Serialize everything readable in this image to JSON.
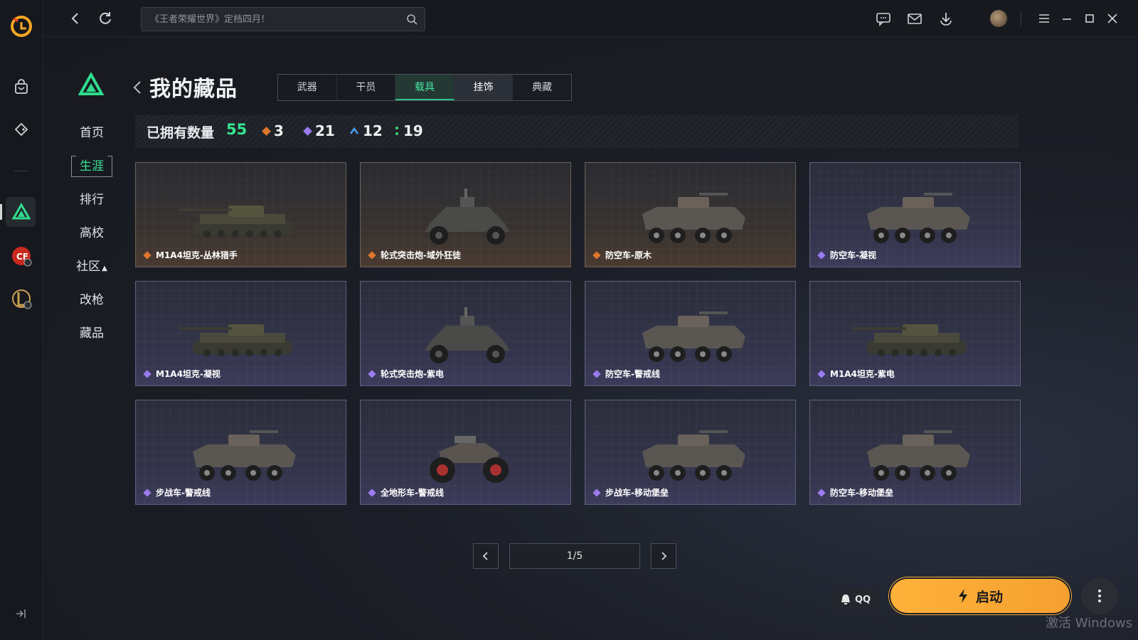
{
  "search": {
    "placeholder": "《王者荣耀世界》定档四月!"
  },
  "menu": {
    "items": [
      {
        "label": "首页"
      },
      {
        "label": "生涯"
      },
      {
        "label": "排行"
      },
      {
        "label": "高校"
      },
      {
        "label": "社区"
      },
      {
        "label": "改枪"
      },
      {
        "label": "藏品"
      }
    ],
    "active": "生涯"
  },
  "page": {
    "title": "我的藏品"
  },
  "tabs": [
    {
      "label": "武器"
    },
    {
      "label": "干员"
    },
    {
      "label": "载具"
    },
    {
      "label": "挂饰"
    },
    {
      "label": "典藏"
    }
  ],
  "stats": {
    "owned_label": "已拥有数量",
    "owned_total": "55",
    "orange_count": "3",
    "purple_count": "21",
    "blue_count": "12",
    "green_count": "19"
  },
  "colors": {
    "accent_green": "#36e68e",
    "rarity_orange": "#e0772f",
    "rarity_purple": "#9a7cf0",
    "rarity_blue": "#4ea0f0",
    "rarity_green": "#3fd27a",
    "start_button": "#ffb23a"
  },
  "cards": [
    {
      "name": "M1A4坦克-丛林猎手",
      "rarity": "orange",
      "type": "tank"
    },
    {
      "name": "轮式突击炮-域外狂徒",
      "rarity": "orange",
      "type": "buggy"
    },
    {
      "name": "防空车-原木",
      "rarity": "orange",
      "type": "apc"
    },
    {
      "name": "防空车-凝视",
      "rarity": "purple",
      "type": "apc"
    },
    {
      "name": "M1A4坦克-凝视",
      "rarity": "purple",
      "type": "tank"
    },
    {
      "name": "轮式突击炮-紫电",
      "rarity": "purple",
      "type": "buggy"
    },
    {
      "name": "防空车-警戒线",
      "rarity": "purple",
      "type": "apc"
    },
    {
      "name": "M1A4坦克-紫电",
      "rarity": "purple",
      "type": "tank"
    },
    {
      "name": "步战车-警戒线",
      "rarity": "purple",
      "type": "apc"
    },
    {
      "name": "全地形车-警戒线",
      "rarity": "purple",
      "type": "atv"
    },
    {
      "name": "步战车-移动堡垒",
      "rarity": "purple",
      "type": "apc"
    },
    {
      "name": "防空车-移动堡垒",
      "rarity": "purple",
      "type": "apc"
    }
  ],
  "pager": {
    "text": "1/5"
  },
  "launch": {
    "qq_label": "QQ",
    "start_label": "启动"
  },
  "watermark": "激活 Windows",
  "icons": [
    "app-logo-icon",
    "bag-icon",
    "tag-icon",
    "delta-force-icon",
    "cf-icon",
    "lol-icon",
    "collapse-icon",
    "back-icon",
    "refresh-icon",
    "search-icon",
    "chat-icon",
    "mail-icon",
    "download-icon",
    "menu-icon",
    "minimize-icon",
    "maximize-icon",
    "close-icon",
    "lightning-icon",
    "more-icon",
    "bell-icon"
  ]
}
